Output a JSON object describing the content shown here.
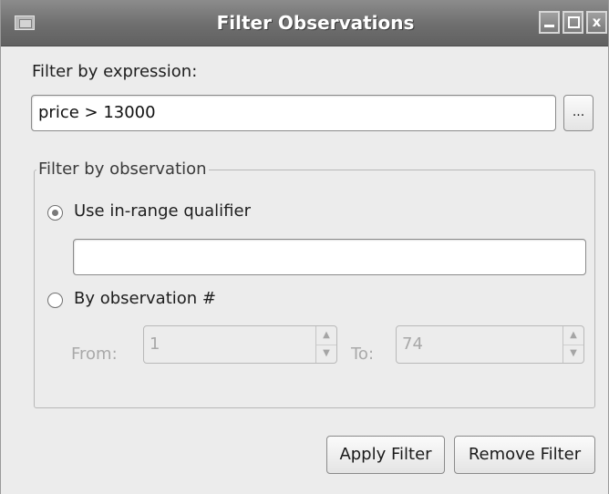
{
  "window": {
    "title": "Filter Observations",
    "icon": "app-icon",
    "controls": {
      "minimize": "minimize-icon",
      "maximize": "maximize-icon",
      "close": "close-icon",
      "close_glyph": "x"
    }
  },
  "expression": {
    "label": "Filter by expression:",
    "value": "price > 13000",
    "browse_label": "..."
  },
  "observation_group": {
    "legend": "Filter by observation",
    "in_range": {
      "label": "Use in-range qualifier",
      "selected": true,
      "value": ""
    },
    "by_number": {
      "label": "By observation #",
      "selected": false,
      "from_label": "From:",
      "from_value": "1",
      "to_label": "To:",
      "to_value": "74"
    }
  },
  "buttons": {
    "apply": "Apply Filter",
    "remove": "Remove Filter"
  }
}
